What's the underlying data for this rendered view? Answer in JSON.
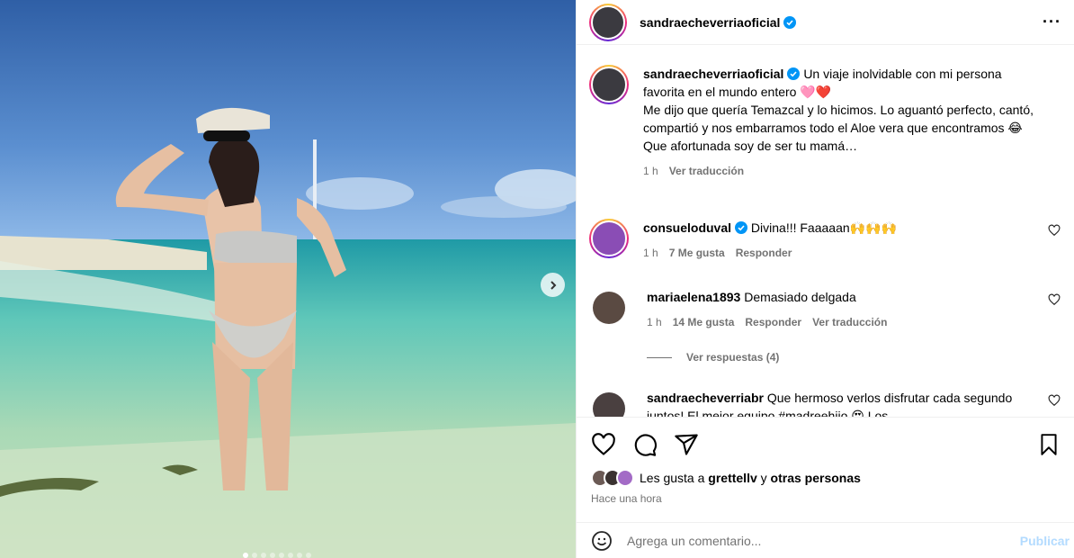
{
  "post": {
    "author": "sandraecheverriaoficial",
    "carousel_count": 8,
    "carousel_active": 1
  },
  "caption": {
    "username": "sandraecheverriaoficial",
    "text": "Un viaje inolvidable con mi persona favorita en el mundo entero 🩷❤️\nMe dijo que quería Temazcal y lo hicimos. Lo aguantó perfecto, cantó, compartió y nos embarramos todo el Aloe vera que encontramos 😂\nQue afortunada soy de ser tu mamá…",
    "time": "1 h",
    "translate": "Ver traducción"
  },
  "comments": [
    {
      "username": "consueloduval",
      "verified": true,
      "text": "Divina!!! Faaaaan🙌🙌🙌",
      "time": "1 h",
      "likes": "7 Me gusta",
      "reply": "Responder",
      "translate": ""
    },
    {
      "username": "mariaelena1893",
      "verified": false,
      "text": "Demasiado delgada",
      "time": "1 h",
      "likes": "14 Me gusta",
      "reply": "Responder",
      "translate": "Ver traducción"
    },
    {
      "username": "sandraecheverriabr",
      "verified": false,
      "text": "Que hermoso verlos disfrutar cada segundo juntos! El mejor equipo #madreehijo 😍 Los",
      "time": "",
      "likes": "",
      "reply": "",
      "translate": ""
    }
  ],
  "view_replies": "Ver respuestas (4)",
  "likes_prefix": "Les gusta a ",
  "likes_user": "grettellv",
  "likes_middle": " y ",
  "likes_others": "otras personas",
  "posted_ago": "Hace una hora",
  "add_comment": {
    "placeholder": "Agrega un comentario...",
    "publish": "Publicar"
  },
  "colors": {
    "verified": "#0095f6",
    "publish_disabled": "#b3dbff",
    "meta_gray": "#737373"
  }
}
